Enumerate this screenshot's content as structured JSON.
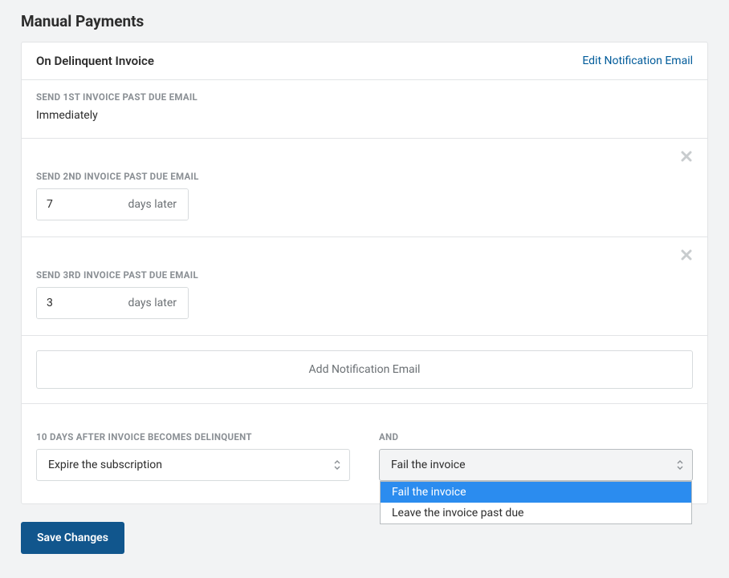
{
  "page_title": "Manual Payments",
  "card": {
    "header_title": "On Delinquent Invoice",
    "edit_link": "Edit Notification Email"
  },
  "email1": {
    "label": "SEND 1ST INVOICE PAST DUE EMAIL",
    "value": "Immediately"
  },
  "email2": {
    "label": "SEND 2ND INVOICE PAST DUE EMAIL",
    "value": "7",
    "suffix": "days later"
  },
  "email3": {
    "label": "SEND 3RD INVOICE PAST DUE EMAIL",
    "value": "3",
    "suffix": "days later"
  },
  "add_button": "Add Notification Email",
  "final": {
    "left_label": "10 DAYS AFTER INVOICE BECOMES DELINQUENT",
    "left_value": "Expire the subscription",
    "right_label": "AND",
    "right_value": "Fail the invoice",
    "options": {
      "0": "Fail the invoice",
      "1": "Leave the invoice past due"
    }
  },
  "save_button": "Save Changes"
}
